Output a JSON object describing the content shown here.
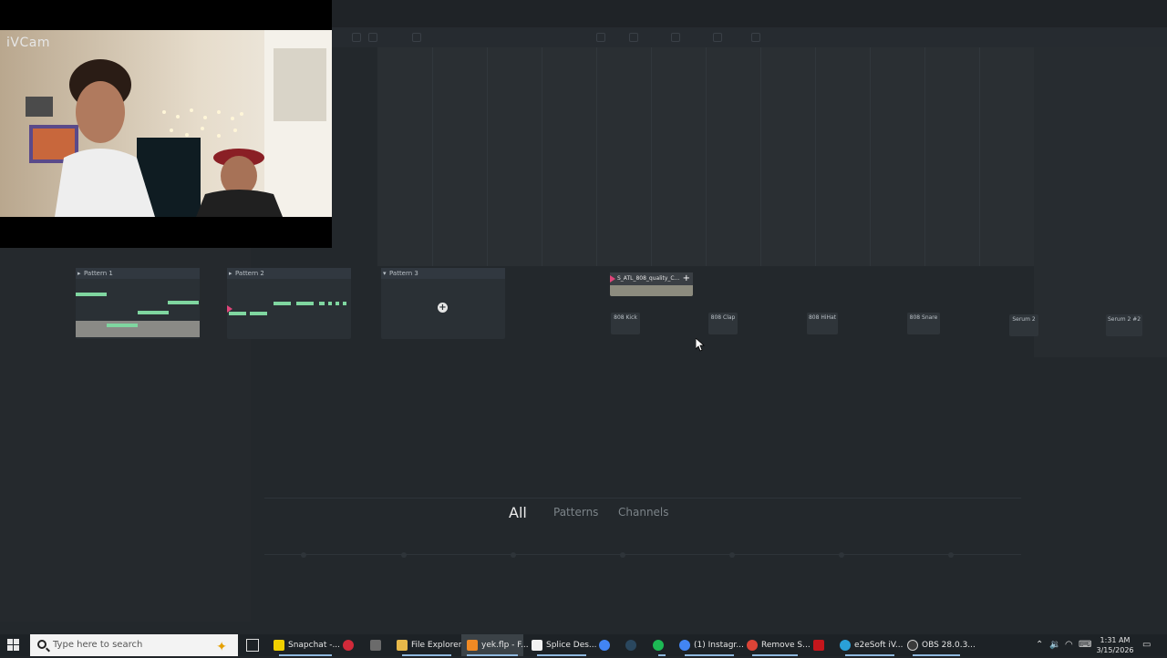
{
  "webcam": {
    "label": "iVCam"
  },
  "patterns": [
    {
      "name": "Pattern 1",
      "selected": true
    },
    {
      "name": "Pattern 2",
      "selected": false
    },
    {
      "name": "Pattern 3",
      "selected": false
    }
  ],
  "add_pattern_icon": "plus-circle-icon",
  "channel_rack": {
    "active_channel": "S_ATL_808_quality_C...",
    "channels": [
      "808 Kick",
      "808 Clap",
      "808 HiHat",
      "808 Snare",
      "Serum 2",
      "Serum 2 #2"
    ]
  },
  "filter_tabs": [
    "All",
    "Patterns",
    "Channels"
  ],
  "active_filter": "All",
  "taskbar": {
    "search_placeholder": "Type here to search",
    "apps": [
      {
        "label": "Snapchat -...",
        "icon": "snapchat-icon",
        "color": "#f0d000"
      },
      {
        "label": "",
        "icon": "recorder-icon",
        "color": "#d12a3a"
      },
      {
        "label": "",
        "icon": "minecraft-icon",
        "color": "#6b6b6b"
      },
      {
        "label": "File Explorer",
        "icon": "folder-icon",
        "color": "#e8b94a"
      },
      {
        "label": "yek.flp - F...",
        "icon": "fl-studio-icon",
        "color": "#f08a24"
      },
      {
        "label": "Splice Des...",
        "icon": "splice-icon",
        "color": "#f2f2f2"
      },
      {
        "label": "",
        "icon": "chrome-icon",
        "color": "#4285f4"
      },
      {
        "label": "",
        "icon": "steam-icon",
        "color": "#1b2838"
      },
      {
        "label": "",
        "icon": "spotify-icon",
        "color": "#1db954"
      },
      {
        "label": "(1) Instagr...",
        "icon": "chrome-icon",
        "color": "#4285f4"
      },
      {
        "label": "Remove S...",
        "icon": "chrome-icon",
        "color": "#db4437"
      },
      {
        "label": "",
        "icon": "pdf-icon",
        "color": "#c4161c"
      },
      {
        "label": "e2eSoft iV...",
        "icon": "ivcam-icon",
        "color": "#2aa0d8"
      },
      {
        "label": "OBS 28.0.3...",
        "icon": "obs-icon",
        "color": "#3a3a3a"
      }
    ],
    "time": "1:31 AM",
    "date": "3/15/2026"
  },
  "colors": {
    "note": "#7fd6a0",
    "active_text": "#ececec",
    "muted_text": "#7b8388"
  }
}
